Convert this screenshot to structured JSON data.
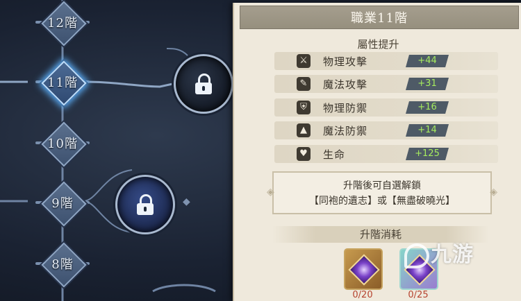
{
  "tree": {
    "nodes": [
      {
        "label": "12階",
        "state": "normal"
      },
      {
        "label": "11階",
        "state": "active"
      },
      {
        "label": "10階",
        "state": "normal"
      },
      {
        "label": "9階",
        "state": "normal"
      },
      {
        "label": "8階",
        "state": "normal"
      }
    ],
    "locked_orbs": [
      {
        "icon": "lock-icon"
      },
      {
        "icon": "lock-icon"
      }
    ]
  },
  "panel": {
    "title": "職業11階",
    "attr_header": "屬性提升",
    "stats": [
      {
        "icon": "sword-icon",
        "glyph": "⚔",
        "name": "物理攻擊",
        "value": "+44"
      },
      {
        "icon": "wand-icon",
        "glyph": "✎",
        "name": "魔法攻擊",
        "value": "+31"
      },
      {
        "icon": "shield-icon",
        "glyph": "⛨",
        "name": "物理防禦",
        "value": "+16"
      },
      {
        "icon": "wizard-hat-icon",
        "glyph": "▲",
        "name": "魔法防禦",
        "value": "+14"
      },
      {
        "icon": "heart-icon",
        "glyph": "♥",
        "name": "生命",
        "value": "+125"
      }
    ],
    "unlock_line1": "升階後可自選解鎖",
    "unlock_line2": "【同袍的遺志】或【無盡破曉光】",
    "cost_header": "升階消耗",
    "costs": [
      {
        "icon": "gold-gem-item-icon",
        "count": "0/20"
      },
      {
        "icon": "teal-gem-item-icon",
        "count": "0/25"
      }
    ]
  },
  "watermark": {
    "text": "九游"
  },
  "colors": {
    "accent_glow": "#5fb4ff",
    "stat_value": "#a6ec5e",
    "cost_red": "#b6432f",
    "panel_bg": "#efe9dc"
  }
}
